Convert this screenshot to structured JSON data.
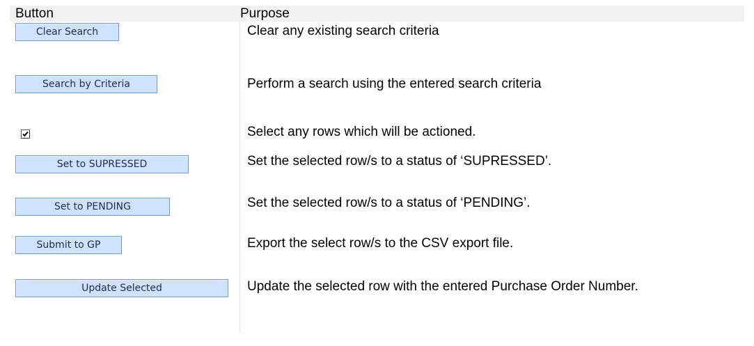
{
  "table": {
    "header": {
      "col1": "Button",
      "col2": "Purpose"
    },
    "rows": [
      {
        "control": "Clear Search",
        "purpose": "Clear any existing search criteria"
      },
      {
        "control": "Search by Criteria",
        "purpose": "Perform a search using the entered search criteria"
      },
      {
        "control": "",
        "purpose": "Select any rows which will be actioned."
      },
      {
        "control": "Set to SUPRESSED",
        "purpose": "Set the selected row/s to a status of ‘SUPRESSED’."
      },
      {
        "control": "Set to PENDING",
        "purpose": "Set the selected row/s to a status of ‘PENDING’."
      },
      {
        "control": "Submit to GP",
        "purpose": "Export the select row/s to the CSV export file."
      },
      {
        "control": "Update Selected",
        "purpose": "Update the selected row with the entered Purchase Order Number."
      }
    ]
  },
  "checkbox_checked": true,
  "colors": {
    "button_fill": "#cfe2ff",
    "button_border": "#6f9ccf",
    "header_fill": "#f2f2f2"
  }
}
